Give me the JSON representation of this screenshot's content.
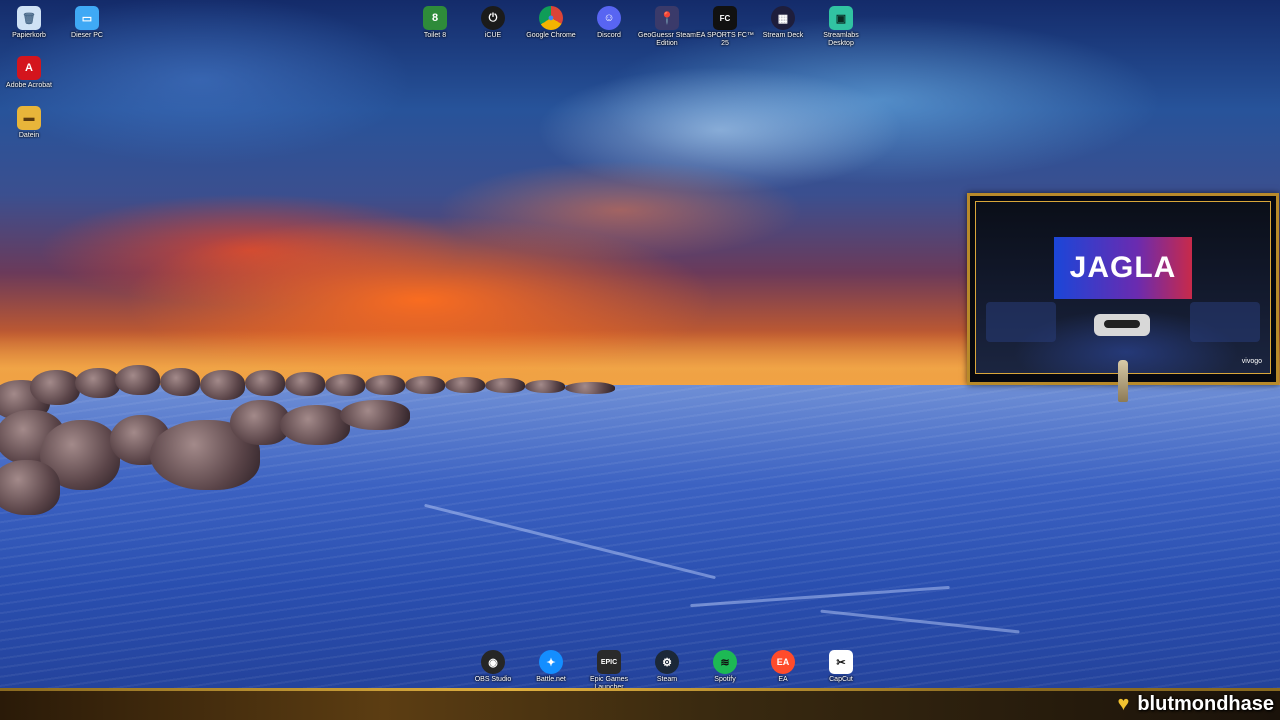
{
  "desktop_icons_left": [
    {
      "id": "recycle-bin",
      "label": "Papierkorb",
      "icon": "recycle-bin-icon",
      "color": "#8fb5dd"
    },
    {
      "id": "this-pc",
      "label": "Dieser PC",
      "icon": "monitor-icon",
      "color": "#3fa9f5"
    },
    {
      "id": "adobe-acrobat",
      "label": "Adobe Acrobat",
      "icon": "acrobat-icon",
      "color": "#d4151d"
    },
    {
      "id": "dateien",
      "label": "Datein",
      "icon": "folder-icon",
      "color": "#e8b53a"
    }
  ],
  "desktop_icons_top": [
    {
      "id": "toilet-8",
      "label": "Toilet 8",
      "icon": "toilet8-icon",
      "color": "#2e8b3a",
      "glyph": "8"
    },
    {
      "id": "icue",
      "label": "iCUE",
      "icon": "icue-icon",
      "color": "#1b1b1b",
      "glyph": "⏻"
    },
    {
      "id": "google-chrome",
      "label": "Google Chrome",
      "icon": "chrome-icon",
      "color": "#db4437",
      "glyph": "●"
    },
    {
      "id": "discord",
      "label": "Discord",
      "icon": "discord-icon",
      "color": "#5865f2",
      "glyph": "☺"
    },
    {
      "id": "geoguessr",
      "label": "GeoGuessr Steam Edition",
      "icon": "map-pin-icon",
      "color": "#3a3a6a",
      "glyph": "📍"
    },
    {
      "id": "ea-sports-fc",
      "label": "EA SPORTS FC™ 25",
      "icon": "ea-fc-icon",
      "color": "#111111",
      "glyph": "FC"
    },
    {
      "id": "stream-deck",
      "label": "Stream Deck",
      "icon": "stream-deck-icon",
      "color": "#1e1e3c",
      "glyph": "▦"
    },
    {
      "id": "streamlabs",
      "label": "Streamlabs Desktop",
      "icon": "streamlabs-icon",
      "color": "#31c3a2",
      "glyph": "▣"
    }
  ],
  "desktop_icons_bottom": [
    {
      "id": "obs",
      "label": "OBS Studio",
      "icon": "obs-icon",
      "color": "#262626",
      "glyph": "◉"
    },
    {
      "id": "battlenet",
      "label": "Battle.net",
      "icon": "battlenet-icon",
      "color": "#148eff",
      "glyph": "✦"
    },
    {
      "id": "epic",
      "label": "Epic Games Launcher",
      "icon": "epic-games-icon",
      "color": "#2a2a2a",
      "glyph": "EPIC"
    },
    {
      "id": "steam",
      "label": "Steam",
      "icon": "steam-icon",
      "color": "#1b2838",
      "glyph": "⚙"
    },
    {
      "id": "spotify",
      "label": "Spotify",
      "icon": "spotify-icon",
      "color": "#1db954",
      "glyph": "≋"
    },
    {
      "id": "ea",
      "label": "EA",
      "icon": "ea-icon",
      "color": "#ff4b2b",
      "glyph": "EA"
    },
    {
      "id": "capcut",
      "label": "CapCut",
      "icon": "capcut-icon",
      "color": "#ffffff",
      "glyph": "✂"
    }
  ],
  "webcam_overlay": {
    "screen_text": "JAGLA",
    "logo_text": "vivogo"
  },
  "stream_bar": {
    "streamer_name": "blutmondhase",
    "heart_icon": "heart-icon",
    "accent_color": "#f2c230"
  }
}
